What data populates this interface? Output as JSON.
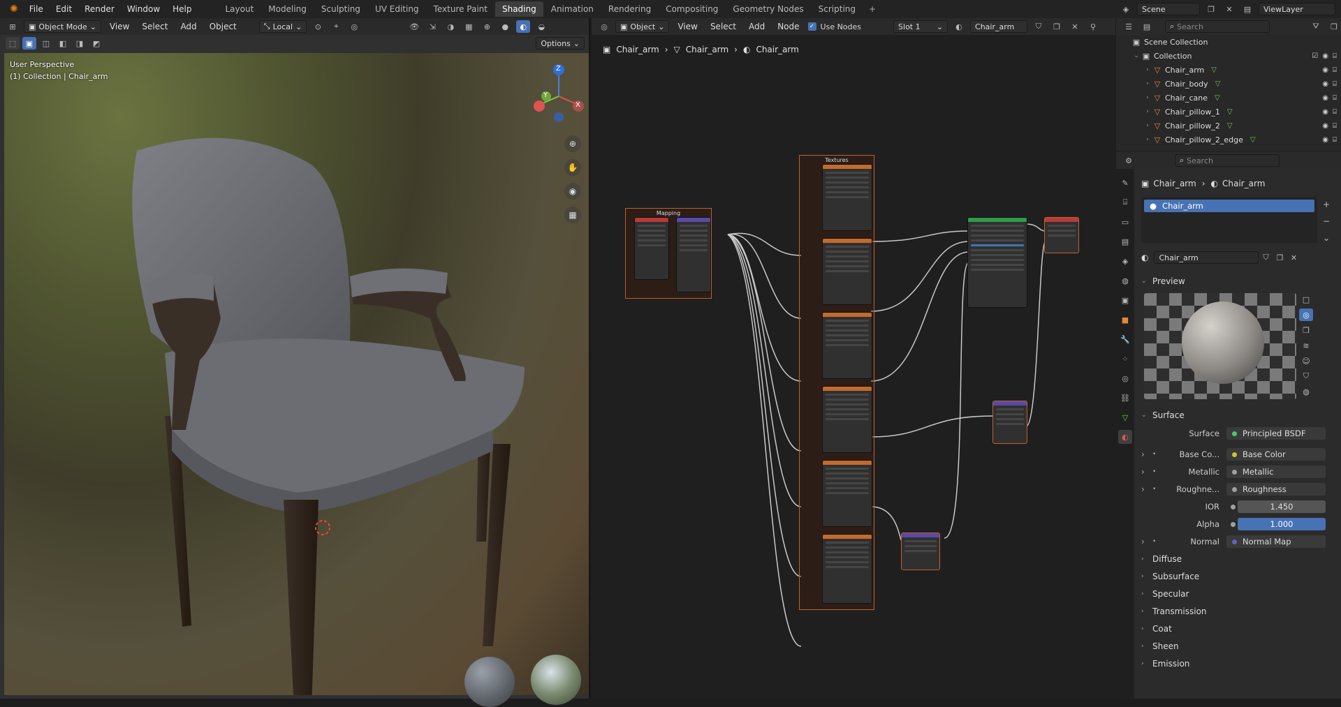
{
  "topbar": {
    "menus": [
      "File",
      "Edit",
      "Render",
      "Window",
      "Help"
    ],
    "workspace_tabs": [
      "Layout",
      "Modeling",
      "Sculpting",
      "UV Editing",
      "Texture Paint",
      "Shading",
      "Animation",
      "Rendering",
      "Compositing",
      "Geometry Nodes",
      "Scripting"
    ],
    "active_tab": "Shading",
    "scene": "Scene",
    "view_layer": "ViewLayer"
  },
  "viewport": {
    "mode": "Object Mode",
    "menus": [
      "View",
      "Select",
      "Add",
      "Object"
    ],
    "transform": "Local",
    "options": "Options",
    "perspective_label": "User Perspective",
    "collection_label": "(1) Collection | Chair_arm",
    "gizmo": {
      "x": "X",
      "y": "Y",
      "z": "Z"
    }
  },
  "node_editor": {
    "type": "Object",
    "menus": [
      "View",
      "Select",
      "Add",
      "Node"
    ],
    "use_nodes": "Use Nodes",
    "slot": "Slot 1",
    "material": "Chair_arm",
    "breadcrumbs": [
      "Chair_arm",
      "Chair_arm",
      "Chair_arm"
    ]
  },
  "outliner": {
    "search_placeholder": "Search",
    "scene_collection": "Scene Collection",
    "collection": "Collection",
    "items": [
      "Chair_arm",
      "Chair_body",
      "Chair_cane",
      "Chair_pillow_1",
      "Chair_pillow_2",
      "Chair_pillow_2_edge"
    ]
  },
  "properties": {
    "search_placeholder": "Search",
    "breadcrumb": [
      "Chair_arm",
      "Chair_arm"
    ],
    "slot_item": "Chair_arm",
    "material_name": "Chair_arm",
    "preview_label": "Preview",
    "surface_section": "Surface",
    "surface": {
      "label": "Surface",
      "value": "Principled BSDF"
    },
    "inputs": [
      {
        "label": "Base Co...",
        "value": "Base Color",
        "color": "#c7c729"
      },
      {
        "label": "Metallic",
        "value": "Metallic",
        "color": "#a1a1a1"
      },
      {
        "label": "Roughne...",
        "value": "Roughness",
        "color": "#a1a1a1"
      }
    ],
    "ior": {
      "label": "IOR",
      "value": "1.450"
    },
    "alpha": {
      "label": "Alpha",
      "value": "1.000"
    },
    "normal": {
      "label": "Normal",
      "value": "Normal Map",
      "color": "#6363c7"
    },
    "subsections": [
      "Diffuse",
      "Subsurface",
      "Specular",
      "Transmission",
      "Coat",
      "Sheen",
      "Emission"
    ]
  },
  "colors": {
    "accent": "#4772b3",
    "frame": "#c0602a",
    "active_tab": "#3d3d3d"
  }
}
